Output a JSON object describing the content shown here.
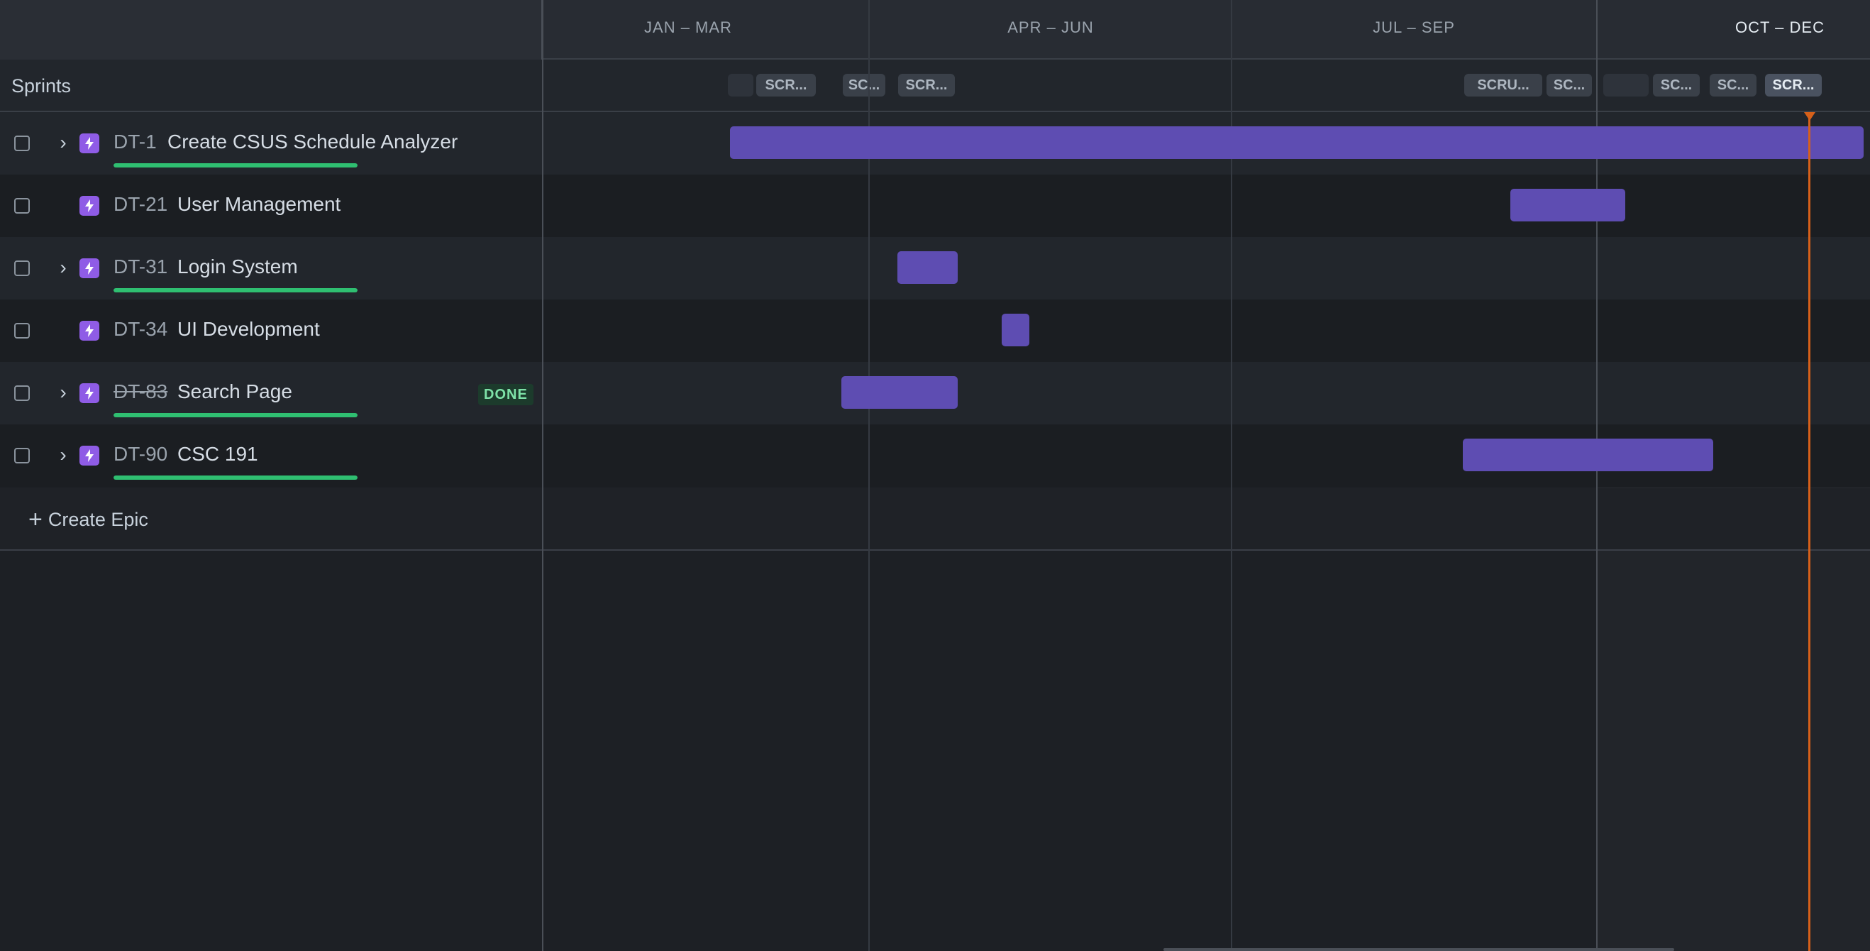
{
  "timeline": {
    "quarters": [
      "JAN – MAR",
      "APR – JUN",
      "JUL – SEP",
      "OCT – DEC"
    ],
    "current_quarter_index": 3
  },
  "sprints": {
    "label": "Sprints",
    "chips": [
      "",
      "SCR...",
      "SC...",
      "SCR...",
      "SCRU...",
      "SC...",
      "",
      "SC...",
      "SC...",
      "SCR..."
    ]
  },
  "epics": [
    {
      "key": "DT-1",
      "summary": "Create CSUS Schedule Analyzer",
      "has_children": true,
      "progress": 1.0,
      "status": "",
      "done": false
    },
    {
      "key": "DT-21",
      "summary": "User Management",
      "has_children": false,
      "progress": null,
      "status": "",
      "done": false
    },
    {
      "key": "DT-31",
      "summary": "Login System",
      "has_children": true,
      "progress": 1.0,
      "status": "",
      "done": false
    },
    {
      "key": "DT-34",
      "summary": "UI Development",
      "has_children": false,
      "progress": null,
      "status": "",
      "done": false
    },
    {
      "key": "DT-83",
      "summary": "Search Page",
      "has_children": true,
      "progress": 1.0,
      "status": "DONE",
      "done": true
    },
    {
      "key": "DT-90",
      "summary": "CSC 191",
      "has_children": true,
      "progress": 1.0,
      "status": "",
      "done": false
    }
  ],
  "create_epic_label": "Create Epic",
  "colors": {
    "bar": "#5e4db2",
    "progress": "#2fbf71",
    "today": "#d6601a",
    "epic_icon": "#8f5ce6"
  }
}
